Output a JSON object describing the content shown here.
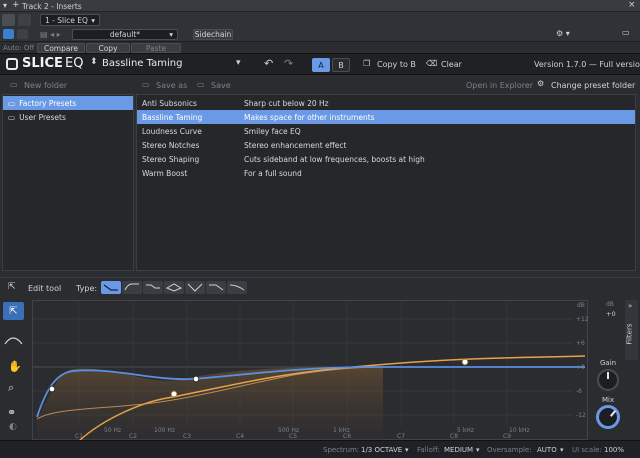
{
  "host": {
    "title": "Track 2 - Inserts",
    "slot_label": "1 - Slice EQ",
    "preset_name": "default*",
    "sidechain_label": "Sidechain",
    "auto_label": "Auto: Off",
    "compare_label": "Compare",
    "copy_label": "Copy",
    "paste_label": "Paste"
  },
  "plugin": {
    "logo_slice": "SLICE",
    "logo_eq": "EQ",
    "current_preset": "Bassline Taming",
    "ab_a": "A",
    "ab_b": "B",
    "copy_to_b": "Copy to B",
    "clear": "Clear",
    "version": "Version 1.7.0 — Full version"
  },
  "browser": {
    "new_folder": "New folder",
    "save_as": "Save as",
    "save": "Save",
    "open_in_explorer": "Open in Explorer",
    "change_preset_folder": "Change preset folder",
    "folders": [
      "Factory Presets",
      "User Presets"
    ],
    "presets": [
      {
        "name": "Anti Subsonics",
        "description": "Sharp cut below 20 Hz"
      },
      {
        "name": "Bassline Taming",
        "description": "Makes space for other instruments"
      },
      {
        "name": "Loudness Curve",
        "description": "Smiley face EQ"
      },
      {
        "name": "Stereo Notches",
        "description": "Stereo enhancement effect"
      },
      {
        "name": "Stereo Shaping",
        "description": "Cuts sideband at low frequences, boosts at high"
      },
      {
        "name": "Warm Boost",
        "description": "For a full sound"
      }
    ]
  },
  "edit": {
    "edit_tool": "Edit tool",
    "type_label": "Type:"
  },
  "graph": {
    "freq_labels": [
      "50 Hz",
      "100 Hz",
      "500 Hz",
      "1 kHz",
      "5 kHz",
      "10 kHz"
    ],
    "note_labels": [
      "C1",
      "C2",
      "C3",
      "C4",
      "C5",
      "C6",
      "C7",
      "C8",
      "C9"
    ],
    "db_labels": [
      "+12",
      "+6",
      "+0",
      "-6",
      "-12"
    ],
    "db_unit": "dB"
  },
  "right": {
    "filters_label": "Filters",
    "db_unit": "dB",
    "db_value": "+0",
    "gain_label": "Gain",
    "mix_label": "Mix"
  },
  "status": {
    "spectrum_label": "Spectrum:",
    "spectrum_value": "1/3 OCTAVE",
    "falloff_label": "Falloff:",
    "falloff_value": "MEDIUM",
    "oversample_label": "Oversample:",
    "oversample_value": "AUTO",
    "ui_scale_label": "UI scale:",
    "ui_scale_value": "100%"
  },
  "colors": {
    "accent_blue": "#6a9ae6",
    "curve_blue": "#5b8fe0",
    "curve_orange": "#e8a24a"
  }
}
